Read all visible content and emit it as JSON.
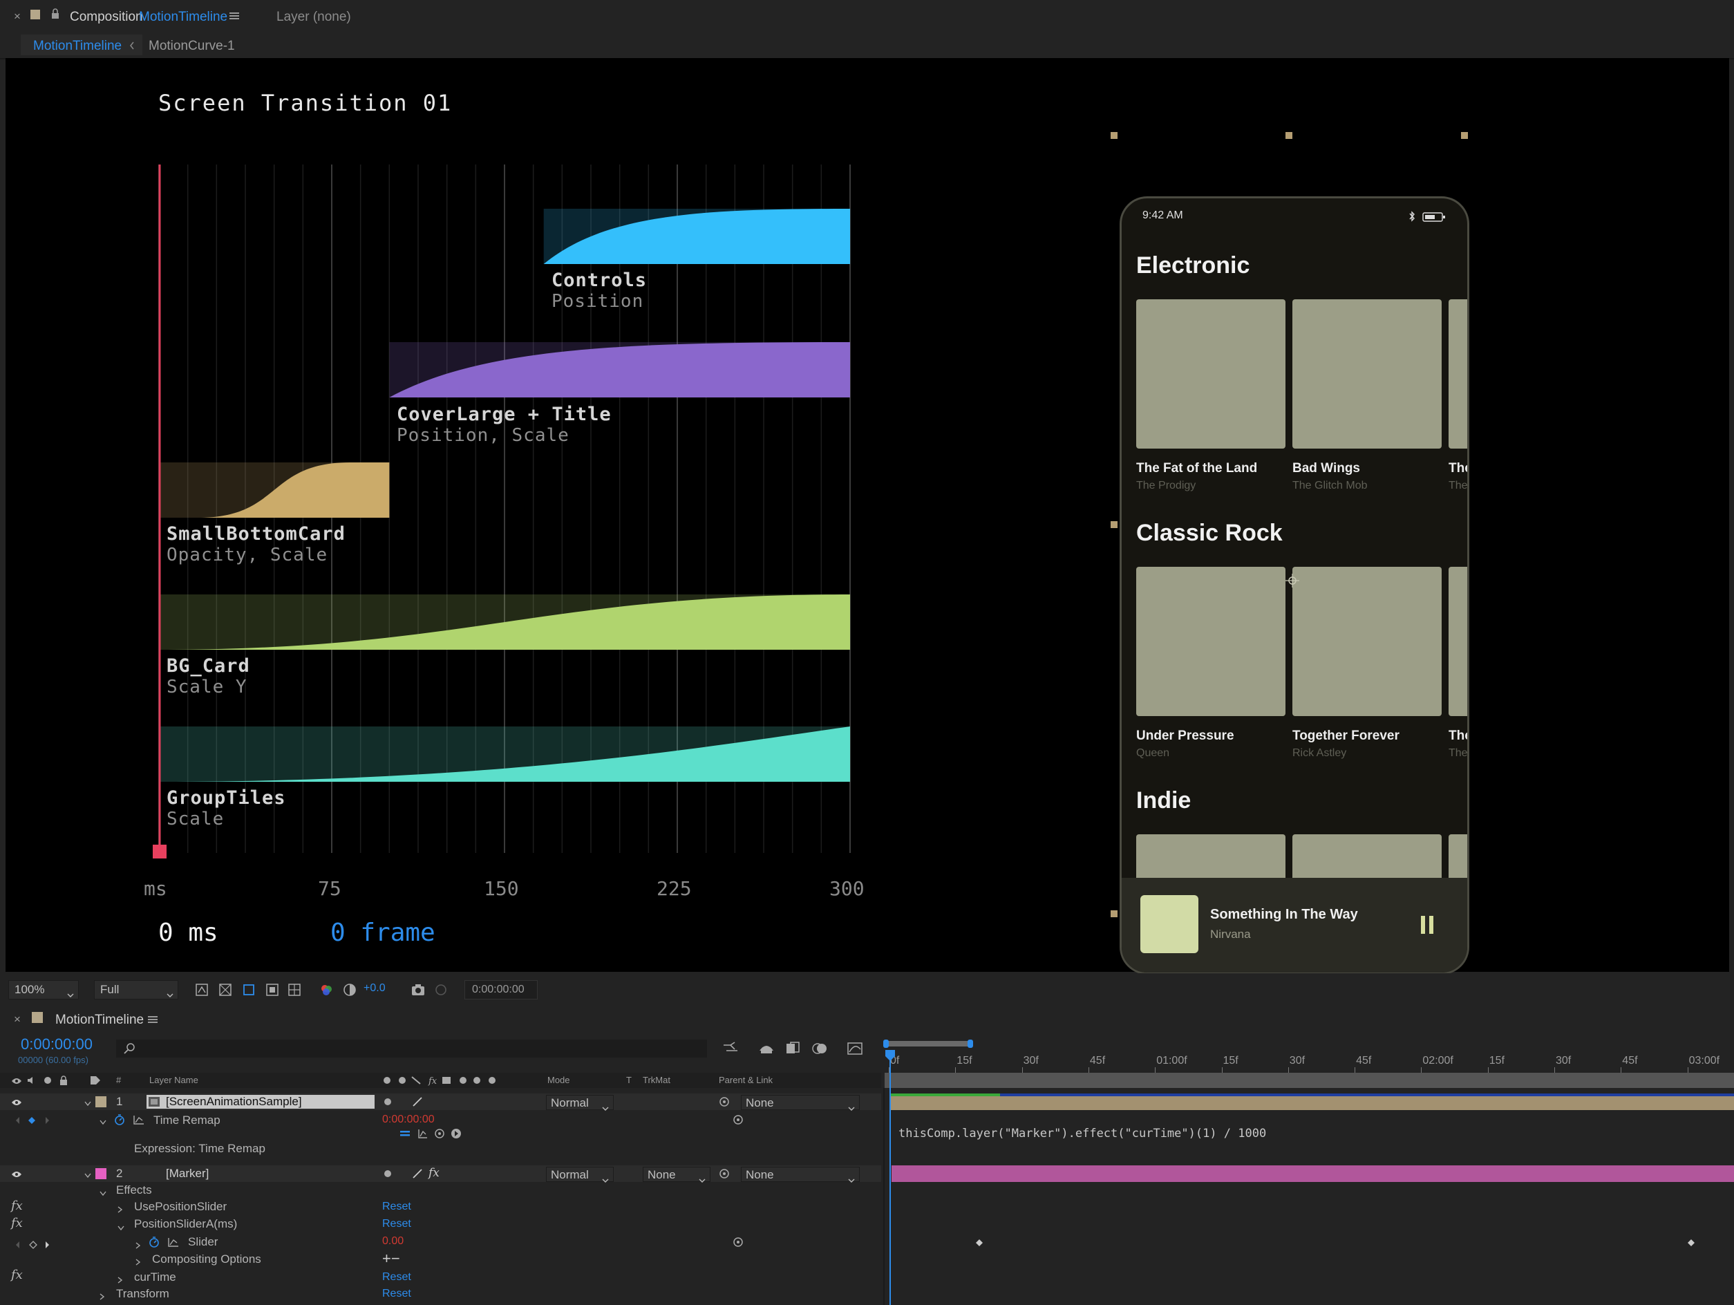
{
  "panel": {
    "close": "×",
    "comp_prefix": "Composition",
    "comp_name": "MotionTimeline",
    "layer_label": "Layer",
    "layer_value": "(none)",
    "breadcrumb": [
      "MotionTimeline",
      "MotionCurve-1"
    ]
  },
  "viewer": {
    "title": "Screen Transition 01",
    "ms_value": "0 ms",
    "frame_value": "0 frame"
  },
  "chart_data": {
    "type": "area",
    "title": "Screen Transition 01",
    "xlabel": "ms",
    "x_ticks": [
      "ms",
      "75",
      "150",
      "225",
      "300"
    ],
    "xlim": [
      0,
      300
    ],
    "series": [
      {
        "name": "Controls",
        "props": "Position",
        "start": 167,
        "end": 300,
        "color": "#34bffb"
      },
      {
        "name": "CoverLarge + Title",
        "props": "Position, Scale",
        "start": 100,
        "end": 300,
        "color": "#8a67cc"
      },
      {
        "name": "SmallBottomCard",
        "props": "Opacity, Scale",
        "start": 0,
        "end": 100,
        "color": "#cbab6a"
      },
      {
        "name": "BG_Card",
        "props": "Scale Y",
        "start": 0,
        "end": 300,
        "color": "#b0d46e"
      },
      {
        "name": "GroupTiles",
        "props": "Scale",
        "start": 0,
        "end": 300,
        "color": "#5cdfcb"
      }
    ]
  },
  "phone": {
    "time": "9:42 AM",
    "sections": [
      {
        "heading": "Electronic",
        "items": [
          {
            "title": "The Fat of the Land",
            "artist": "The Prodigy"
          },
          {
            "title": "Bad Wings",
            "artist": "The Glitch Mob"
          },
          {
            "title": "The",
            "artist": "The"
          }
        ]
      },
      {
        "heading": "Classic Rock",
        "items": [
          {
            "title": "Under Pressure",
            "artist": "Queen"
          },
          {
            "title": "Together Forever",
            "artist": "Rick Astley"
          },
          {
            "title": "The",
            "artist": "The"
          }
        ]
      },
      {
        "heading": "Indie",
        "items": []
      }
    ],
    "now_playing": {
      "title": "Something In The Way",
      "artist": "Nirvana"
    }
  },
  "toolbar": {
    "zoom": "100%",
    "resolution": "Full",
    "exposure": "+0.0",
    "timecode": "0:00:00:00"
  },
  "timeline": {
    "close": "×",
    "comp_name": "MotionTimeline",
    "current_time": "0:00:00:00",
    "frame_info": "00000 (60.00 fps)",
    "columns": {
      "num": "#",
      "layer_name": "Layer Name",
      "mode": "Mode",
      "t": "T",
      "trkmat": "TrkMat",
      "parent": "Parent & Link"
    },
    "ruler": [
      "0f",
      "15f",
      "30f",
      "45f",
      "01:00f",
      "15f",
      "30f",
      "45f",
      "02:00f",
      "15f",
      "30f",
      "45f",
      "03:00f"
    ],
    "layer1": {
      "num": "1",
      "name": "[ScreenAnimationSample]",
      "mode": "Normal",
      "parent": "None"
    },
    "time_remap": {
      "label": "Time Remap",
      "value": "0:00:00:00"
    },
    "expression_label": "Expression: Time Remap",
    "expression_code": "thisComp.layer(\"Marker\").effect(\"curTime\")(1) / 1000",
    "layer2": {
      "num": "2",
      "name": "[Marker]",
      "mode": "Normal",
      "trkmat": "None",
      "parent": "None"
    },
    "effects_label": "Effects",
    "effects": [
      {
        "name": "UsePositionSlider",
        "reset": "Reset"
      },
      {
        "name": "PositionSliderA(ms)",
        "reset": "Reset"
      }
    ],
    "slider": {
      "label": "Slider",
      "value": "0.00"
    },
    "compositing": "Compositing Options",
    "plus_minus": "+−",
    "curtime": {
      "name": "curTime",
      "reset": "Reset"
    },
    "transform": {
      "name": "Transform",
      "reset": "Reset"
    }
  }
}
